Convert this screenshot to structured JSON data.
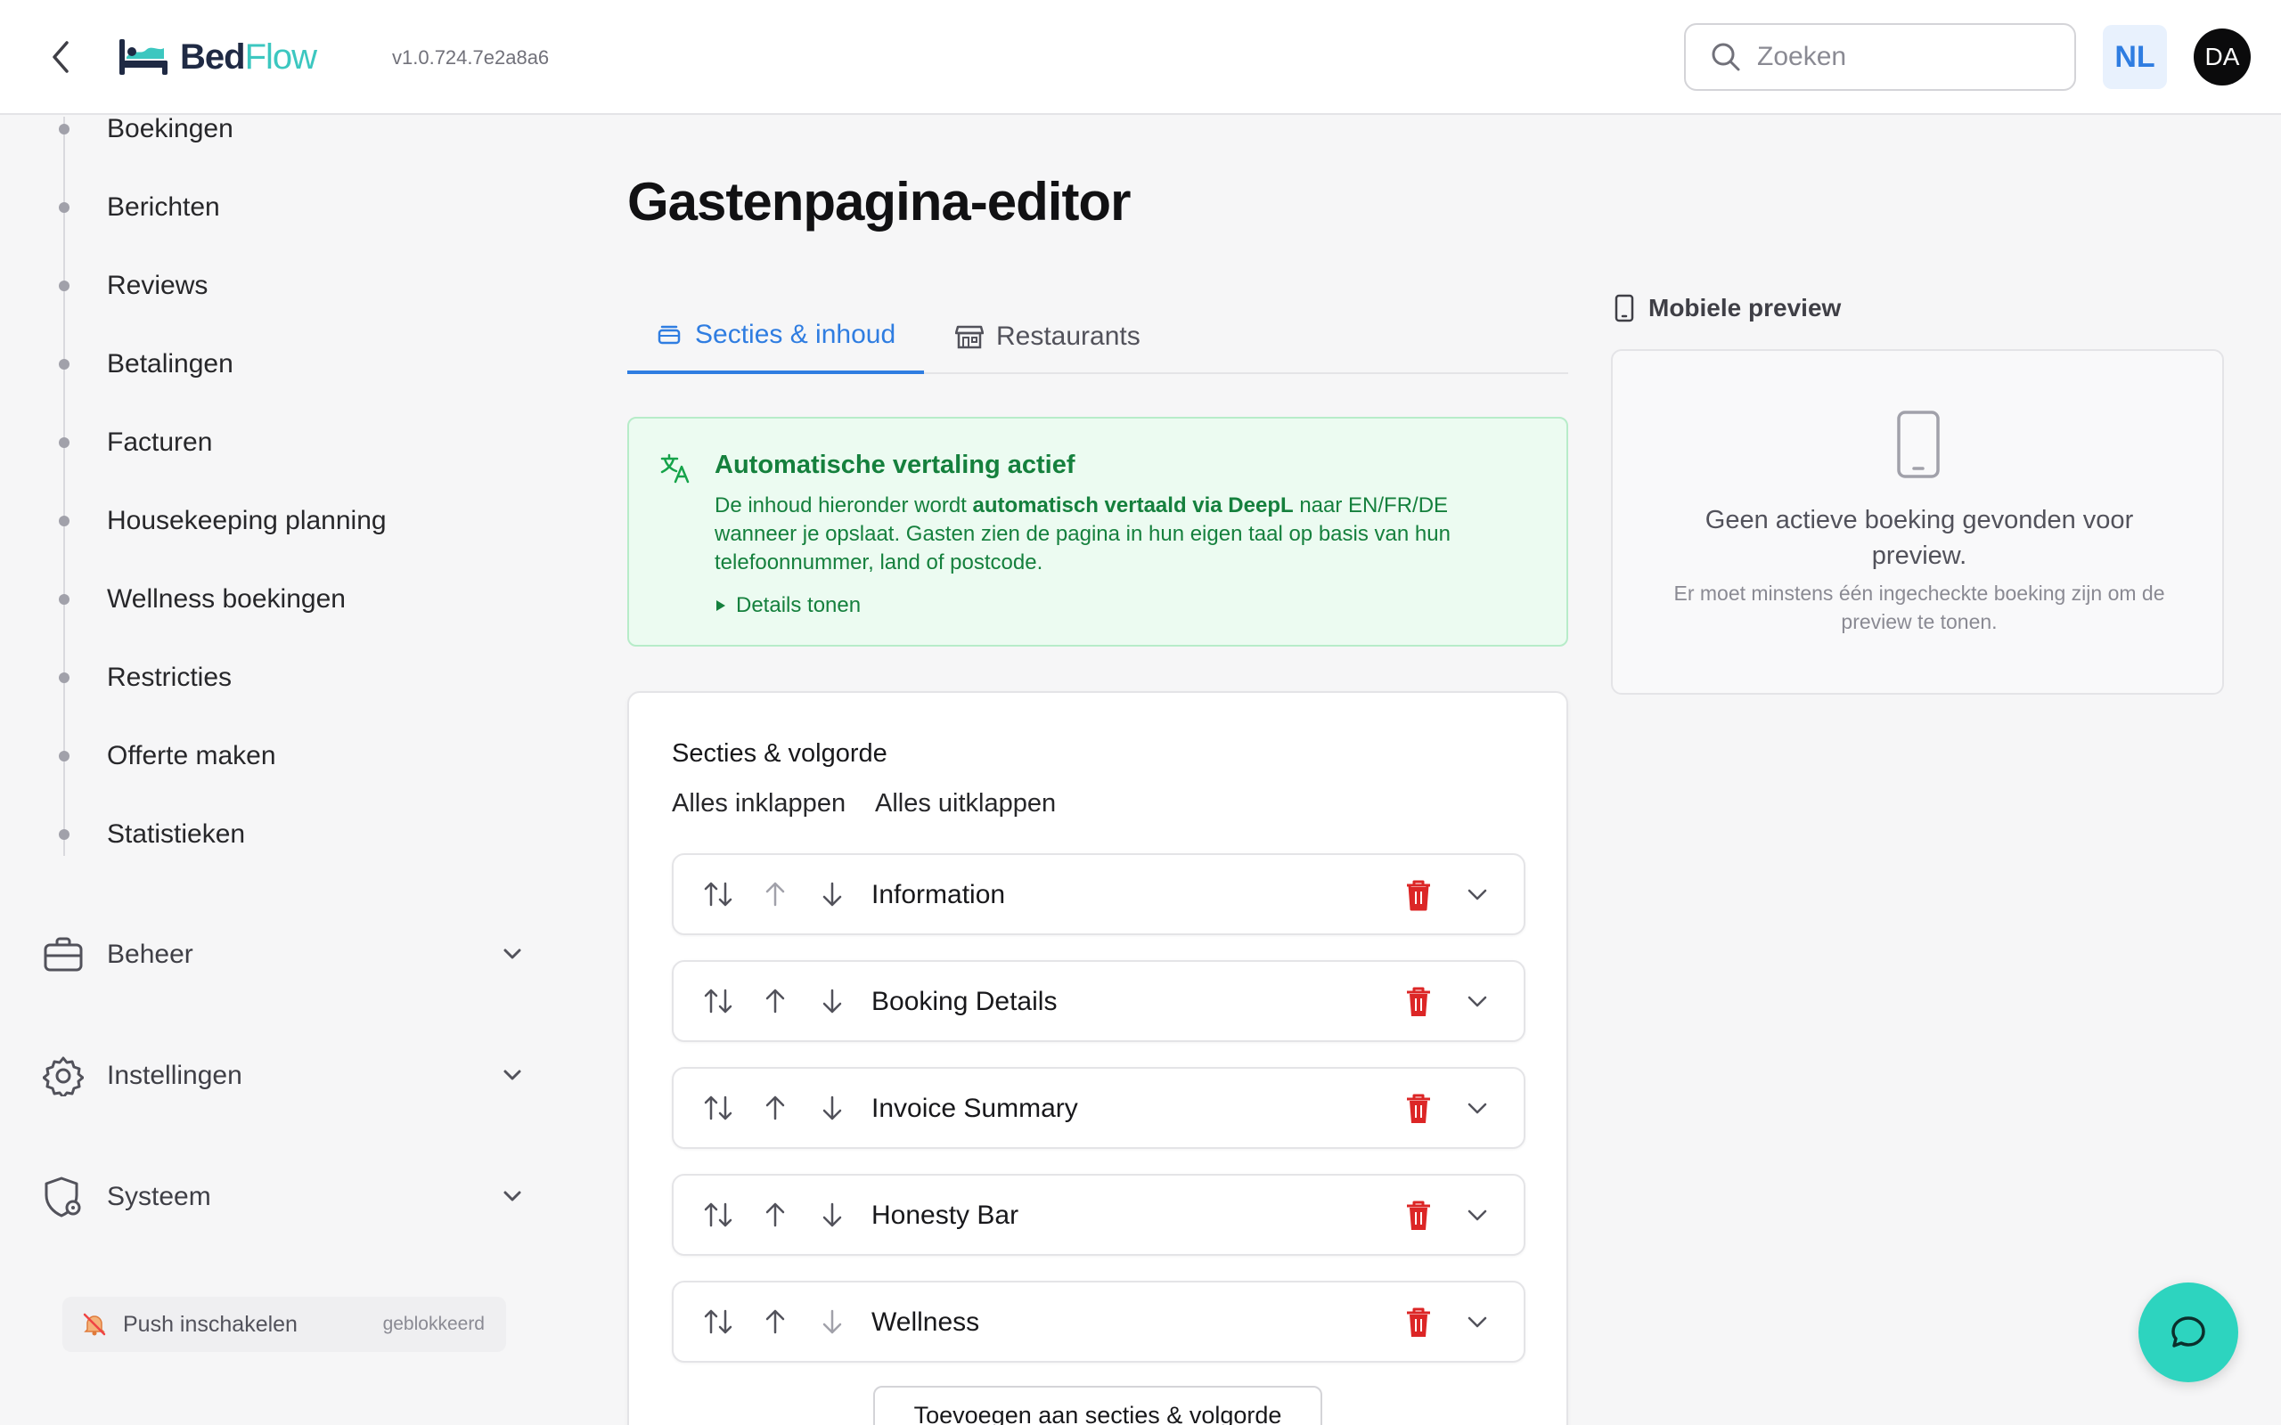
{
  "header": {
    "logo_text_bed": "Bed",
    "logo_text_flow": "Flow",
    "version": "v1.0.724.7e2a8a6",
    "search_placeholder": "Zoeken",
    "language": "NL",
    "user_initials": "DA"
  },
  "sidebar": {
    "items": [
      {
        "label": "Boekingen"
      },
      {
        "label": "Berichten"
      },
      {
        "label": "Reviews"
      },
      {
        "label": "Betalingen"
      },
      {
        "label": "Facturen"
      },
      {
        "label": "Housekeeping planning"
      },
      {
        "label": "Wellness boekingen"
      },
      {
        "label": "Restricties"
      },
      {
        "label": "Offerte maken"
      },
      {
        "label": "Statistieken"
      }
    ],
    "groups": [
      {
        "label": "Beheer",
        "icon": "briefcase-icon"
      },
      {
        "label": "Instellingen",
        "icon": "gear-icon"
      },
      {
        "label": "Systeem",
        "icon": "shield-gear-icon"
      }
    ],
    "push": {
      "label": "Push inschakelen",
      "state": "geblokkeerd"
    }
  },
  "main": {
    "title": "Gastenpagina-editor",
    "tabs": [
      {
        "label": "Secties & inhoud",
        "active": true
      },
      {
        "label": "Restaurants",
        "active": false
      }
    ],
    "notice": {
      "title": "Automatische vertaling actief",
      "body_pre": "De inhoud hieronder wordt ",
      "body_bold": "automatisch vertaald via DeepL",
      "body_post": " naar EN/FR/DE wanneer je opslaat. Gasten zien de pagina in hun eigen taal op basis van hun telefoonnummer, land of postcode.",
      "details": "Details tonen"
    },
    "sections_card": {
      "title": "Secties & volgorde",
      "collapse_all": "Alles inklappen",
      "expand_all": "Alles uitklappen",
      "sections": [
        {
          "name": "Information"
        },
        {
          "name": "Booking Details"
        },
        {
          "name": "Invoice Summary"
        },
        {
          "name": "Honesty Bar"
        },
        {
          "name": "Wellness"
        }
      ],
      "add_button": "Toevoegen aan secties & volgorde"
    }
  },
  "preview": {
    "title": "Mobiele preview",
    "message": "Geen actieve boeking gevonden voor preview.",
    "sub": "Er moet minstens één ingecheckte boeking zijn om de preview te tonen."
  },
  "colors": {
    "accent": "#2f7de1",
    "success_bg": "#ecfbf1",
    "success_text": "#15803d",
    "danger": "#dc2626",
    "chat": "#2dd4bf"
  }
}
